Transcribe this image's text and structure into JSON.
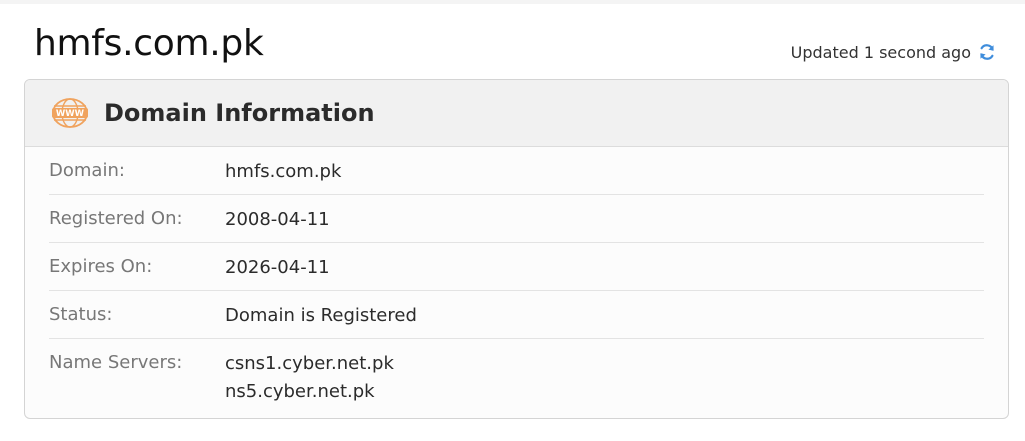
{
  "header": {
    "domain": "hmfs.com.pk",
    "updated_text": "Updated 1 second ago",
    "refresh_icon": "refresh-icon"
  },
  "card": {
    "title": "Domain Information",
    "icon": "www-globe-icon",
    "rows": [
      {
        "label": "Domain:",
        "value": "hmfs.com.pk"
      },
      {
        "label": "Registered On:",
        "value": "2008-04-11"
      },
      {
        "label": "Expires On:",
        "value": "2026-04-11"
      },
      {
        "label": "Status:",
        "value": "Domain is Registered"
      },
      {
        "label": "Name Servers:",
        "values": [
          "csns1.cyber.net.pk",
          "ns5.cyber.net.pk"
        ]
      }
    ]
  },
  "colors": {
    "accent_icon": "#f0a35e",
    "refresh_blue": "#3f8ddc"
  }
}
